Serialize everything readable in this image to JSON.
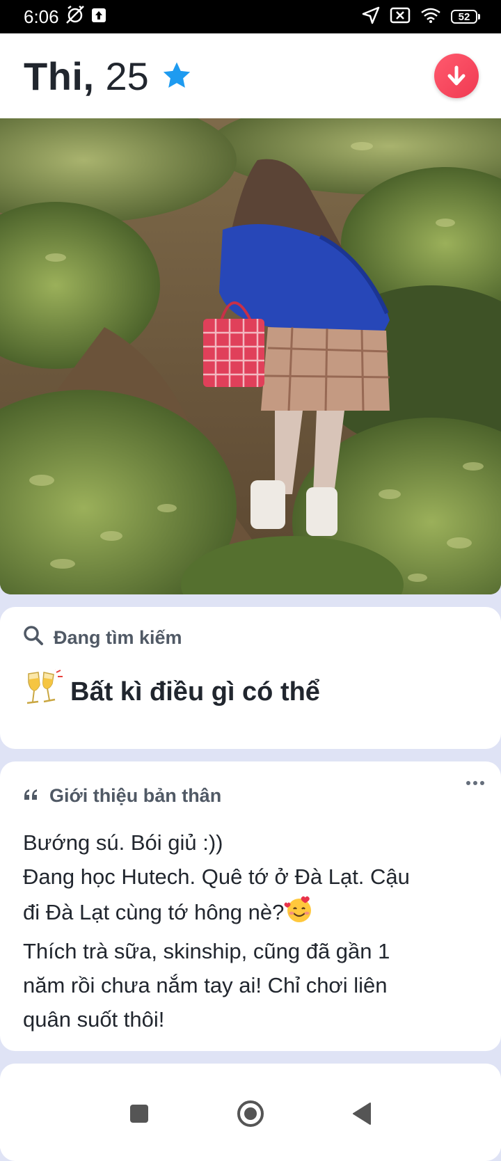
{
  "status_bar": {
    "time": "6:06",
    "battery_level": "52"
  },
  "profile": {
    "name": "Thi,",
    "age": "25"
  },
  "looking_for": {
    "label": "Đang tìm kiếm",
    "value": "Bất kì điều gì có thể"
  },
  "bio": {
    "label": "Giới thiệu bản thân",
    "line1": "Bướng sú. Bói giủ :))",
    "line2": "Đang học Hutech. Quê tớ ở Đà Lạt. Cậu",
    "line3": "đi Đà Lạt cùng tớ hông nè?",
    "line4": "Thích trà sữa, skinship, cũng đã gần 1",
    "line5": "năm rồi chưa nắm tay ai! Chỉ chơi liên",
    "line6": "quân suốt thôi!"
  },
  "icons": {
    "verified": "star-icon",
    "collapse": "arrow-down-icon",
    "search": "search-icon",
    "quote": "quote-icon",
    "more": "more-icon"
  },
  "colors": {
    "accent": "#f03a52",
    "verified": "#1e9bf0",
    "text": "#21262e"
  }
}
